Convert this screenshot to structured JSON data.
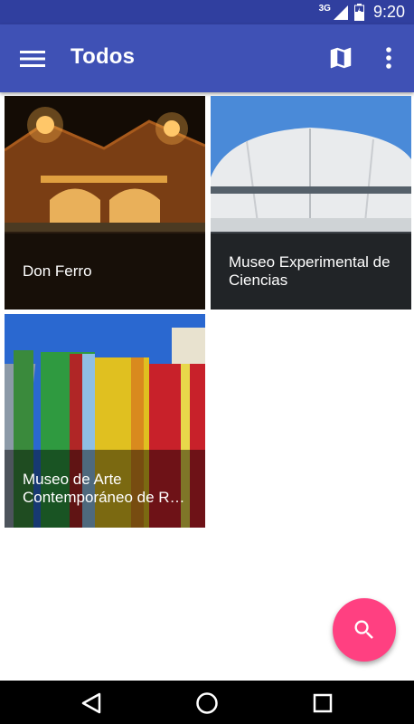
{
  "status_bar": {
    "network": "3G",
    "time": "9:20"
  },
  "app_bar": {
    "title": "Todos",
    "icons": {
      "menu": "menu-icon",
      "map": "map-icon",
      "more": "more-vert-icon"
    },
    "color": "#3F51B5"
  },
  "places": [
    {
      "name": "Don Ferro",
      "lines": [
        "Don Ferro"
      ]
    },
    {
      "name": "Museo Experimental de Ciencias",
      "lines": [
        "Museo Experimental de",
        "Ciencias"
      ]
    },
    {
      "name": "Museo de Arte Contemporáneo de Ro...",
      "lines": [
        "Museo de Arte",
        "Contemporáneo de Ro…"
      ]
    }
  ],
  "fab": {
    "icon": "search-icon",
    "color": "#FF4081"
  },
  "nav_bar": {
    "icons": [
      "back-icon",
      "home-icon",
      "recents-icon"
    ]
  }
}
